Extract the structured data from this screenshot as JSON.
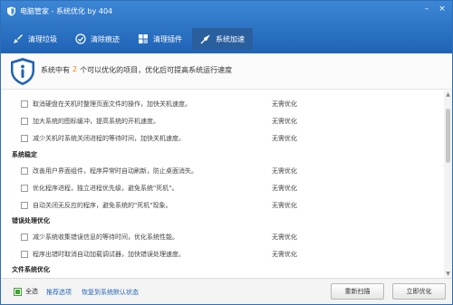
{
  "app": {
    "title": "电脑管家 - 系统优化 by 404"
  },
  "window_controls": {
    "minimize": "–",
    "close": "×"
  },
  "tabs": [
    {
      "label": "清理垃圾",
      "icon": "broom-icon",
      "active": false
    },
    {
      "label": "清除痕迹",
      "icon": "erase-icon",
      "active": false
    },
    {
      "label": "清理插件",
      "icon": "puzzle-icon",
      "active": false
    },
    {
      "label": "系统加速",
      "icon": "rocket-icon",
      "active": true
    }
  ],
  "info": {
    "prefix": "系统中有",
    "count": "2",
    "suffix": "个可以优化的项目，优化后可提高系统运行速度",
    "icon": "info-shield-icon"
  },
  "list": {
    "items": [
      {
        "desc": "取消硬盘在关机时整理页面文件的操作，加快关机速度。",
        "status": "无需优化"
      },
      {
        "desc": "加大系统的图标缓冲，提高系统的开机速度。",
        "status": "无需优化"
      },
      {
        "desc": "减少关机时系统关闭进程的等待时间，加快关机速度。",
        "status": "无需优化"
      },
      {
        "desc": "改善用户界面组件，程序异常时自动刷新，防止桌面消失。",
        "status": "无需优化"
      },
      {
        "desc": "优化程序进程，独立进程优先级，避免系统\"死机\"。",
        "status": "无需优化"
      },
      {
        "desc": "自动关闭无反应的程序，避免系统的\"死机\"现象。",
        "status": "无需优化"
      },
      {
        "desc": "减少系统收集错误信息的等待时间，优化系统性能。",
        "status": "无需优化"
      },
      {
        "desc": "程序出错时取消自动加载调试器，加快错误处理速度。",
        "status": "无需优化"
      }
    ],
    "sections": [
      "系统稳定",
      "错误处理优化",
      "文件系统优化"
    ]
  },
  "footer": {
    "select_all": "全选",
    "recommended": "推荐选项",
    "restore": "恢复到系统默认状态",
    "rescan": "重新扫描",
    "optimize": "立即优化"
  },
  "colors": {
    "accent": "#2468b8",
    "highlight": "#f07d00",
    "check": "#3fa52e"
  }
}
